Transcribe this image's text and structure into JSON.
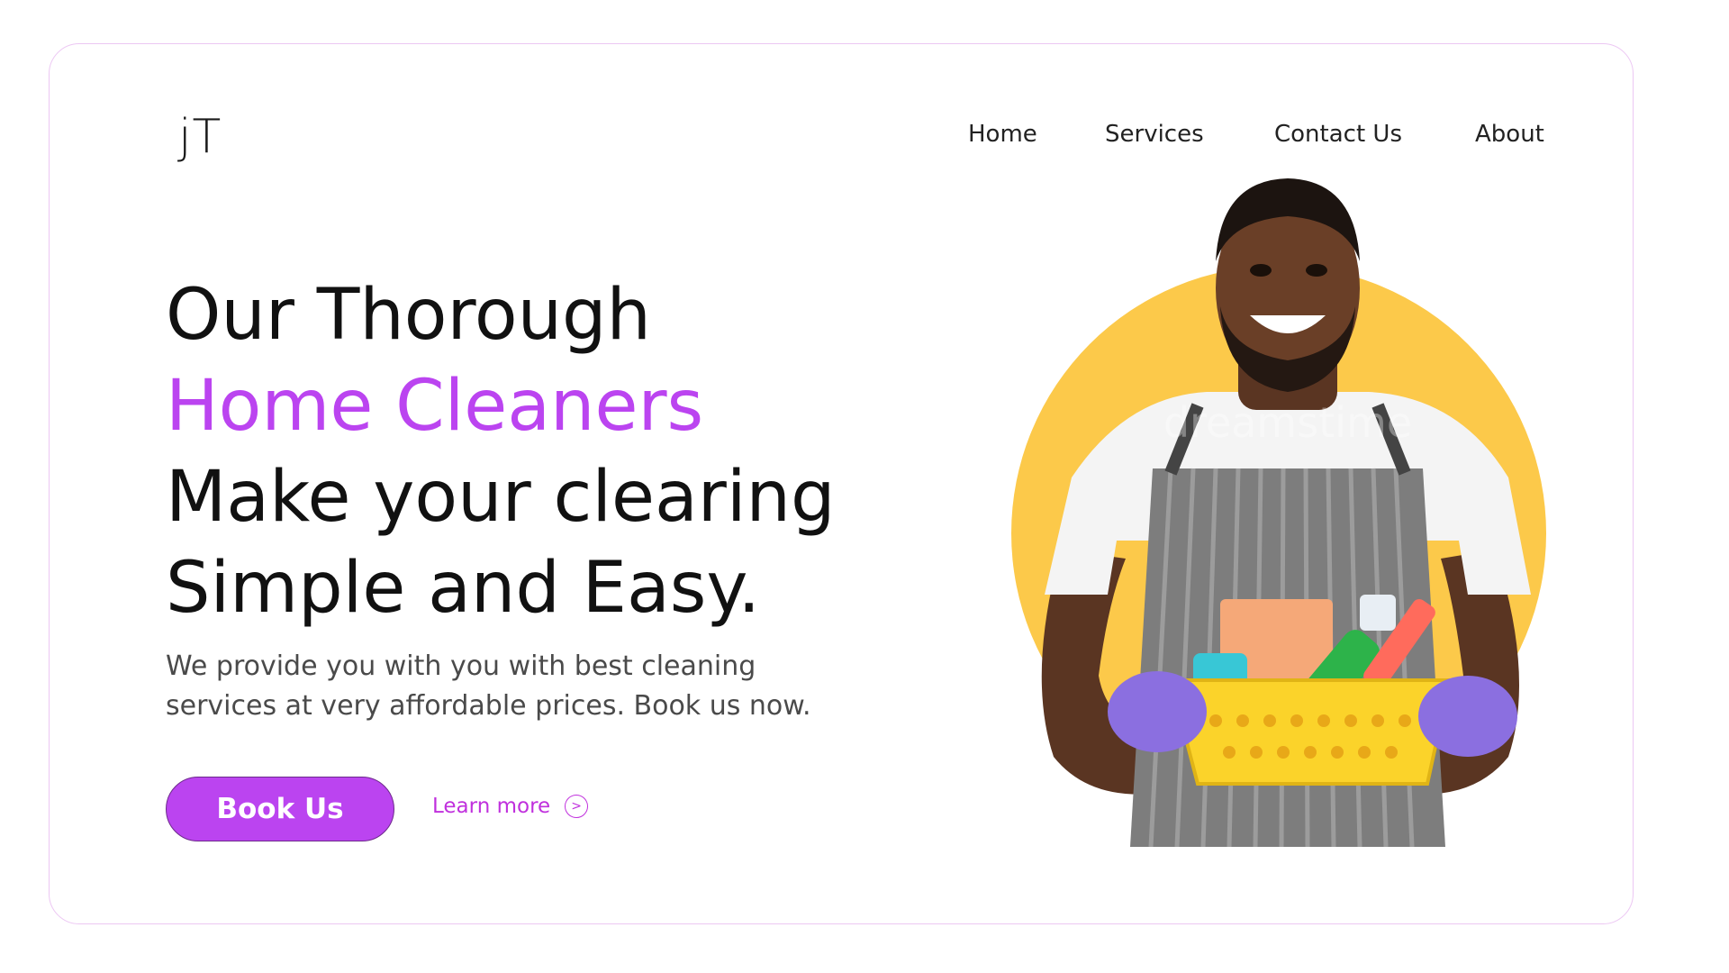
{
  "brand": {
    "logo": "jT"
  },
  "nav": {
    "items": [
      {
        "label": "Home"
      },
      {
        "label": "Services"
      },
      {
        "label": "Contact Us"
      },
      {
        "label": "About"
      }
    ]
  },
  "hero": {
    "headline": {
      "part1": "Our Thorough ",
      "accent": "Home Cleaners",
      "part2": " Make your clearing Simple and Easy."
    },
    "subtext": "We provide you with you with best cleaning services at very affordable prices. Book us now.",
    "primary_button": "Book Us",
    "secondary_link": "Learn more",
    "secondary_icon": "chevron-right-circle-icon"
  },
  "image": {
    "watermark": "dreamstime"
  },
  "colors": {
    "accent": "#bb44f0",
    "circle": "#fcc94a",
    "border": "#ecc7f3"
  }
}
